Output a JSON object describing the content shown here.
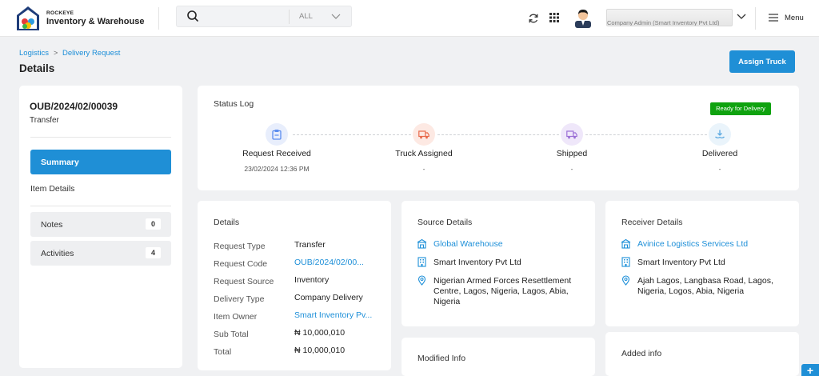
{
  "header": {
    "brand_small": "ROCKEYE",
    "brand_title": "Inventory & Warehouse",
    "search_placeholder": "",
    "search_scope": "ALL",
    "user_company": "Company Admin (Smart Inventory Pvt Ltd)",
    "menu_label": "Menu"
  },
  "breadcrumb": {
    "items": [
      "Logistics",
      "Delivery Request"
    ],
    "separator": ">"
  },
  "page": {
    "title": "Details",
    "assign_button": "Assign Truck"
  },
  "sidebar": {
    "reference": "OUB/2024/02/00039",
    "type": "Transfer",
    "nav": [
      {
        "label": "Summary",
        "active": true
      },
      {
        "label": "Item Details"
      },
      {
        "label": "Notes",
        "count": "0"
      },
      {
        "label": "Activities",
        "count": "4"
      }
    ]
  },
  "status_log": {
    "title": "Status Log",
    "badge": "Ready for Delivery",
    "steps": [
      {
        "label": "Request Received",
        "date": "23/02/2024 12:36 PM",
        "icon": "clipboard-icon",
        "color": "#5b8def",
        "bg": "#e8eefc"
      },
      {
        "label": "Truck Assigned",
        "date": "-",
        "icon": "truck-icon",
        "color": "#e8694a",
        "bg": "#fde9e3"
      },
      {
        "label": "Shipped",
        "date": "-",
        "icon": "truck-icon",
        "color": "#9b6fd6",
        "bg": "#efe7fa"
      },
      {
        "label": "Delivered",
        "date": "-",
        "icon": "delivered-icon",
        "color": "#5aa8e0",
        "bg": "#eaf4fb"
      }
    ]
  },
  "details": {
    "title": "Details",
    "rows": [
      {
        "label": "Request Type",
        "value": "Transfer",
        "link": false
      },
      {
        "label": "Request Code",
        "value": "OUB/2024/02/00...",
        "link": true
      },
      {
        "label": "Request Source",
        "value": "Inventory",
        "link": false
      },
      {
        "label": "Delivery Type",
        "value": "Company Delivery",
        "link": false
      },
      {
        "label": "Item Owner",
        "value": "Smart Inventory Pv...",
        "link": true
      },
      {
        "label": "Sub Total",
        "value": "₦ 10,000,010",
        "link": false
      },
      {
        "label": "Total",
        "value": "₦ 10,000,010",
        "link": false
      }
    ]
  },
  "source": {
    "title": "Source Details",
    "warehouse": "Global Warehouse",
    "company": "Smart Inventory Pvt Ltd",
    "address": "Nigerian Armed Forces Resettlement Centre, Lagos, Nigeria, Lagos, Abia, Nigeria"
  },
  "receiver": {
    "title": "Receiver Details",
    "name": "Avinice Logistics Services Ltd",
    "company": "Smart Inventory Pvt Ltd",
    "address": "Ajah Lagos, Langbasa Road, Lagos, Nigeria, Logos, Abia, Nigeria"
  },
  "modified": {
    "title": "Modified Info"
  },
  "added": {
    "title": "Added info"
  },
  "fab_label": "+"
}
